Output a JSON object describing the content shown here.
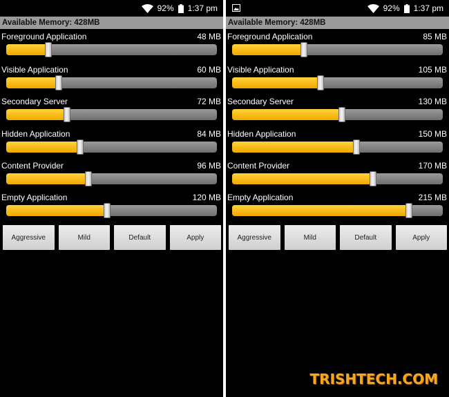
{
  "screens": [
    {
      "status": {
        "battery": "92%",
        "time": "1:37 pm"
      },
      "header": "Available Memory: 428MB",
      "sliders": [
        {
          "label": "Foreground Application",
          "value": "48 MB",
          "percent": 20
        },
        {
          "label": "Visible Application",
          "value": "60 MB",
          "percent": 25
        },
        {
          "label": "Secondary Server",
          "value": "72 MB",
          "percent": 29
        },
        {
          "label": "Hidden Application",
          "value": "84 MB",
          "percent": 35
        },
        {
          "label": "Content Provider",
          "value": "96 MB",
          "percent": 39
        },
        {
          "label": "Empty Application",
          "value": "120 MB",
          "percent": 48
        }
      ],
      "buttons": [
        "Aggressive",
        "Mild",
        "Default",
        "Apply"
      ]
    },
    {
      "status": {
        "battery": "92%",
        "time": "1:37 pm"
      },
      "header": "Available Memory: 428MB",
      "sliders": [
        {
          "label": "Foreground Application",
          "value": "85 MB",
          "percent": 34
        },
        {
          "label": "Visible Application",
          "value": "105 MB",
          "percent": 42
        },
        {
          "label": "Secondary Server",
          "value": "130 MB",
          "percent": 52
        },
        {
          "label": "Hidden Application",
          "value": "150 MB",
          "percent": 59
        },
        {
          "label": "Content Provider",
          "value": "170 MB",
          "percent": 67
        },
        {
          "label": "Empty Application",
          "value": "215 MB",
          "percent": 84
        }
      ],
      "buttons": [
        "Aggressive",
        "Mild",
        "Default",
        "Apply"
      ]
    }
  ],
  "watermark": "TRISHTECH.COM",
  "colors": {
    "fill": "#f5b800",
    "track": "#808080",
    "header_bg": "#9b9b9b",
    "screen_bg": "#000000"
  },
  "icons": [
    "wifi-icon",
    "battery-icon",
    "gallery-icon"
  ]
}
